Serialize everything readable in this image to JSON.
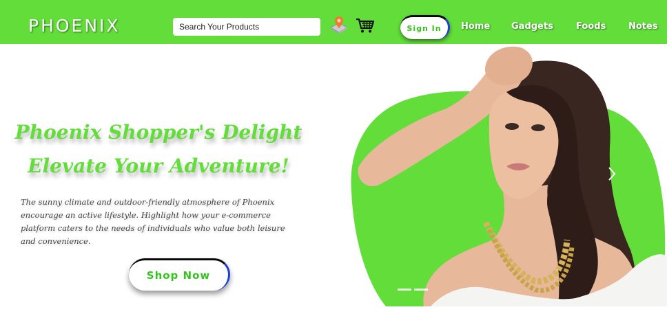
{
  "header": {
    "logo": "PHOENIX",
    "search_placeholder": "Search Your Products",
    "location_icon": "location-pin-icon",
    "cart_icon": "shopping-cart-icon",
    "signin_label": "Sign In",
    "nav": [
      {
        "label": "Home"
      },
      {
        "label": "Gadgets"
      },
      {
        "label": "Foods"
      },
      {
        "label": "Notes"
      }
    ]
  },
  "hero": {
    "title_line1": "Phoenix Shopper's Delight",
    "title_line2": "Elevate Your Adventure!",
    "description": "The sunny climate and outdoor-friendly atmosphere of Phoenix encourage an active lifestyle. Highlight how your e-commerce platform caters to the needs of individuals who value both leisure and convenience.",
    "cta_label": "Shop Now",
    "next_icon": "chevron-right-icon"
  },
  "colors": {
    "brand_green": "#62dd3a",
    "button_text": "#33c31d",
    "button_border_dark": "#0a0a0a",
    "button_border_blue": "#1e3fd8"
  }
}
